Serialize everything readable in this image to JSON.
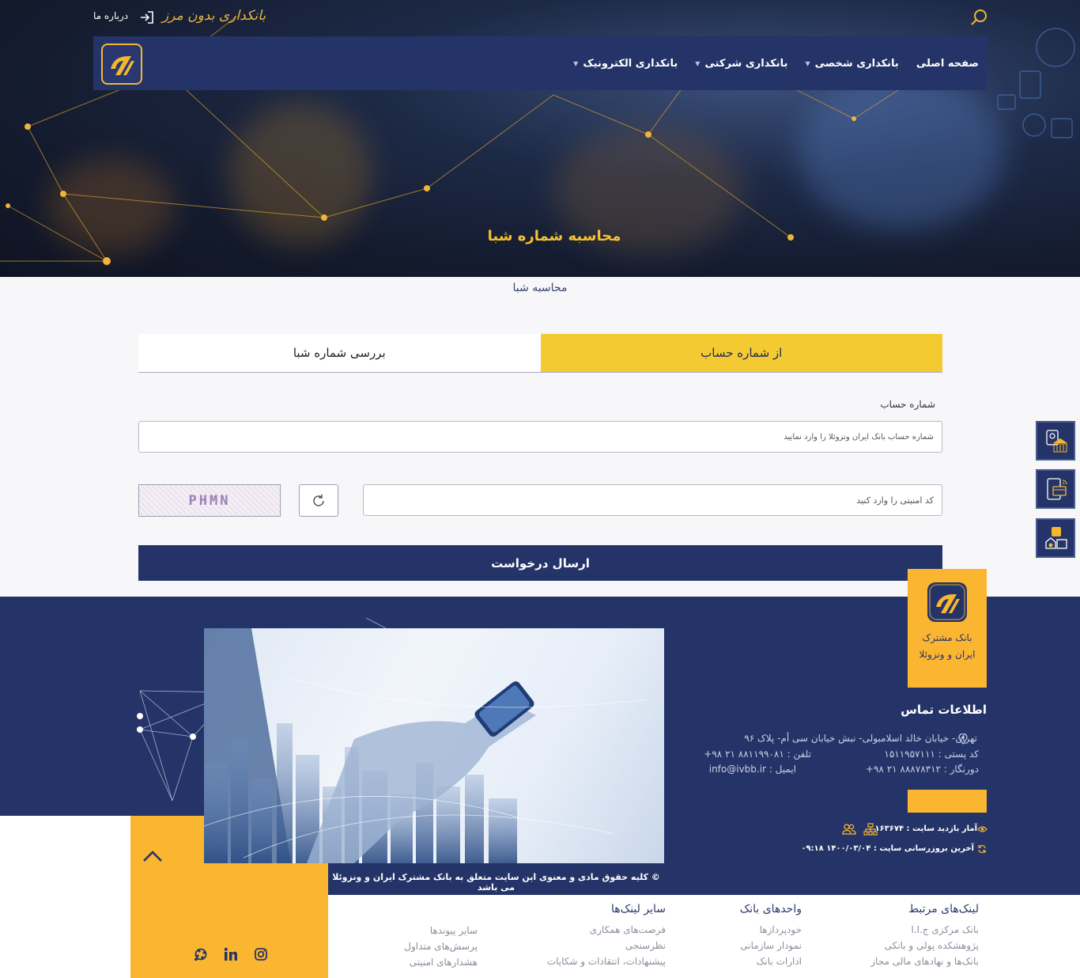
{
  "header": {
    "slogan": "بانکداری بدون مرز",
    "about_label": "درباره ما",
    "nav": [
      {
        "label": "صفحه اصلی",
        "dropdown": false
      },
      {
        "label": "بانکداری شخصی",
        "dropdown": true
      },
      {
        "label": "بانکداری شرکتی",
        "dropdown": true
      },
      {
        "label": "بانکداری الکترونیک",
        "dropdown": true
      }
    ]
  },
  "hero": {
    "title": "محاسبه شماره شبا"
  },
  "breadcrumb": "محاسبه شبا",
  "tabs": [
    {
      "label": "از شماره حساب",
      "active": true
    },
    {
      "label": "بررسی شماره شبا",
      "active": false
    }
  ],
  "form": {
    "account_label": "شماره حساب",
    "account_placeholder": "شماره حساب بانک ایران ونزوئلا را وارد نمایید",
    "captcha_placeholder": "کد امنیتی را وارد کنید",
    "captcha_text": "PHMN",
    "submit_label": "ارسال درخواست"
  },
  "footer": {
    "brand_line1": "بانک مشترک",
    "brand_line2": "ایران و ونزوئلا",
    "contact_title": "اطلاعات تماس",
    "address": "تهران- خیابان خالد اسلامبولی- نبش خیابان سی أم- پلاک ۹۶",
    "postal": "کد پستی : ۱۵۱۱۹۵۷۱۱۱",
    "phone": "تلفن : ۸۸۱۱۹۹۰۸۱ ۲۱ ۹۸+",
    "fax": "دورنگار : ۸۸۸۷۸۳۱۲ ۲۱ ۹۸+",
    "email": "ایمیل : info@ivbb.ir",
    "visits": "آمار بازدید سایت : ۱۶۳۶۷۴",
    "last_update": "آخرین بروزرسانی سایت : ۱۴۰۰/۰۳/۰۴ ۰۹:۱۸",
    "copyright": "© کلیه حقوق مادی و معنوی این سایت متعلق به بانک مشترک ایران و ونزوئلا می باشد",
    "columns": [
      {
        "title": "لینک‌های مرتبط",
        "items": [
          "بانک مرکزی ج.ا.ا",
          "پژوهشکده پولی و بانکی",
          "بانک‌ها و نهادهای مالی مجاز"
        ]
      },
      {
        "title": "واحدهای بانک",
        "items": [
          "خودپردازها",
          "نمودار سازمانی",
          "ادارات بانک"
        ]
      },
      {
        "title": "سایر لینک‌ها",
        "items": [
          "فرصت‌های همکاری",
          "نظرسنجی",
          "پیشنهادات، انتقادات و شکایات"
        ]
      },
      {
        "title": "",
        "items": [
          "سایر پیوندها",
          "پرسش‌های متداول",
          "هشدارهای امنیتی"
        ]
      }
    ]
  },
  "colors": {
    "navy": "#253468",
    "yellow": "#fbb631",
    "tab_yellow": "#f3ca31"
  }
}
